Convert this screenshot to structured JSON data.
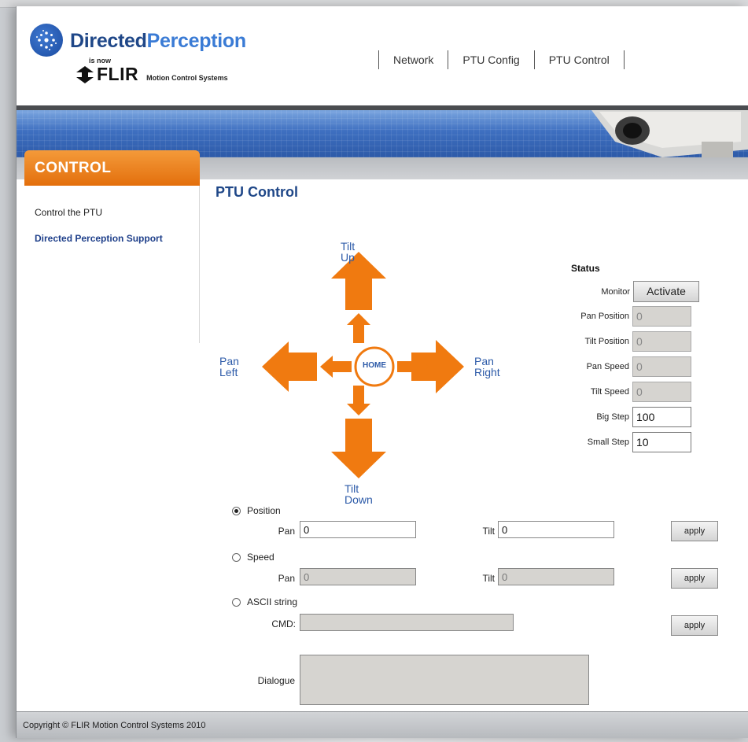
{
  "header": {
    "brand_part1": "Directed",
    "brand_part2": "Perception",
    "is_now": "is now",
    "flir": "FLIR",
    "flir_sub": "Motion Control Systems",
    "nav": [
      "Network",
      "PTU Config",
      "PTU Control"
    ]
  },
  "sidebar": {
    "tab_label": "CONTROL",
    "items": [
      "Control the PTU",
      "Directed Perception Support"
    ]
  },
  "main": {
    "title": "PTU Control",
    "dpad": {
      "tilt_up": "Tilt Up",
      "tilt_down": "Tilt Down",
      "pan_left_1": "Pan",
      "pan_left_2": "Left",
      "pan_right_1": "Pan",
      "pan_right_2": "Right",
      "home": "HOME"
    }
  },
  "status": {
    "title": "Status",
    "monitor_label": "Monitor",
    "activate_label": "Activate",
    "fields": [
      {
        "label": "Pan Position",
        "value": "0"
      },
      {
        "label": "Tilt Position",
        "value": "0"
      },
      {
        "label": "Pan Speed",
        "value": "0"
      },
      {
        "label": "Tilt Speed",
        "value": "0"
      },
      {
        "label": "Big Step",
        "value": "100"
      },
      {
        "label": "Small Step",
        "value": "10"
      }
    ]
  },
  "controls": {
    "position": {
      "label": "Position",
      "pan_label": "Pan",
      "pan_value": "0",
      "tilt_label": "Tilt",
      "tilt_value": "0",
      "apply": "apply"
    },
    "speed": {
      "label": "Speed",
      "pan_label": "Pan",
      "pan_value": "0",
      "tilt_label": "Tilt",
      "tilt_value": "0",
      "apply": "apply"
    },
    "ascii": {
      "label": "ASCII string",
      "cmd_label": "CMD:",
      "cmd_value": "",
      "apply": "apply"
    },
    "dialogue_label": "Dialogue"
  },
  "footer": {
    "copyright": "Copyright © FLIR Motion Control Systems 2010"
  },
  "colors": {
    "accent": "#e36f0c",
    "brand_blue": "#1f4788",
    "arrow": "#f07a10"
  }
}
